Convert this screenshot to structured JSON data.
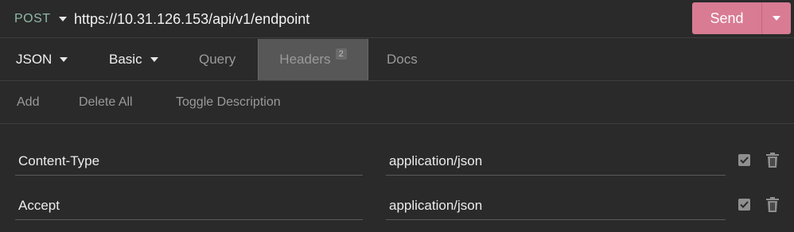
{
  "request": {
    "method": "POST",
    "url": "https://10.31.126.153/api/v1/endpoint",
    "send_label": "Send"
  },
  "tabs": {
    "body": "JSON",
    "auth": "Basic",
    "query": "Query",
    "headers": "Headers",
    "headers_count": "2",
    "docs": "Docs"
  },
  "actions": {
    "add": "Add",
    "delete_all": "Delete All",
    "toggle_description": "Toggle Description"
  },
  "headers": [
    {
      "name": "Content-Type",
      "value": "application/json",
      "enabled": true
    },
    {
      "name": "Accept",
      "value": "application/json",
      "enabled": true
    }
  ],
  "colors": {
    "accent_send": "#d87b93",
    "method_text": "#8fb9a8",
    "background": "#2a2a2a"
  }
}
